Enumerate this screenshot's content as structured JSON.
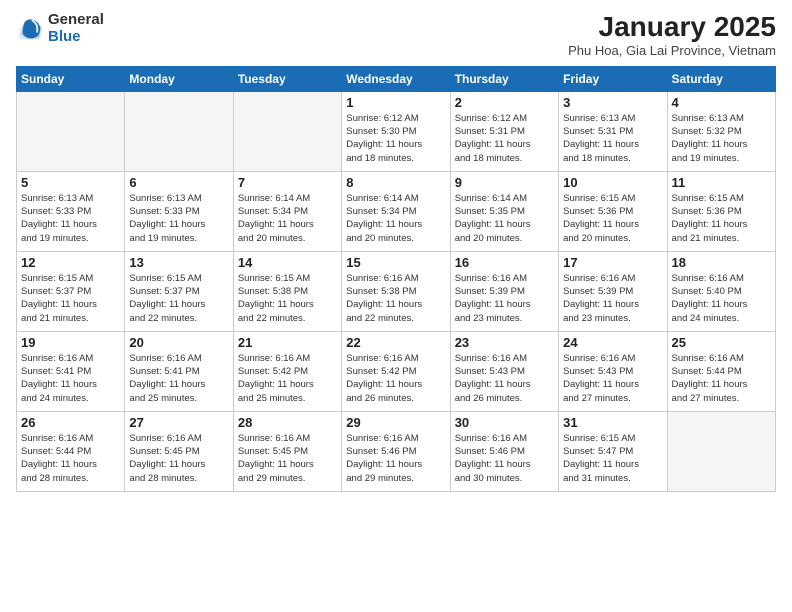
{
  "logo": {
    "general": "General",
    "blue": "Blue"
  },
  "header": {
    "month": "January 2025",
    "location": "Phu Hoa, Gia Lai Province, Vietnam"
  },
  "weekdays": [
    "Sunday",
    "Monday",
    "Tuesday",
    "Wednesday",
    "Thursday",
    "Friday",
    "Saturday"
  ],
  "weeks": [
    [
      {
        "day": "",
        "info": ""
      },
      {
        "day": "",
        "info": ""
      },
      {
        "day": "",
        "info": ""
      },
      {
        "day": "1",
        "info": "Sunrise: 6:12 AM\nSunset: 5:30 PM\nDaylight: 11 hours\nand 18 minutes."
      },
      {
        "day": "2",
        "info": "Sunrise: 6:12 AM\nSunset: 5:31 PM\nDaylight: 11 hours\nand 18 minutes."
      },
      {
        "day": "3",
        "info": "Sunrise: 6:13 AM\nSunset: 5:31 PM\nDaylight: 11 hours\nand 18 minutes."
      },
      {
        "day": "4",
        "info": "Sunrise: 6:13 AM\nSunset: 5:32 PM\nDaylight: 11 hours\nand 19 minutes."
      }
    ],
    [
      {
        "day": "5",
        "info": "Sunrise: 6:13 AM\nSunset: 5:33 PM\nDaylight: 11 hours\nand 19 minutes."
      },
      {
        "day": "6",
        "info": "Sunrise: 6:13 AM\nSunset: 5:33 PM\nDaylight: 11 hours\nand 19 minutes."
      },
      {
        "day": "7",
        "info": "Sunrise: 6:14 AM\nSunset: 5:34 PM\nDaylight: 11 hours\nand 20 minutes."
      },
      {
        "day": "8",
        "info": "Sunrise: 6:14 AM\nSunset: 5:34 PM\nDaylight: 11 hours\nand 20 minutes."
      },
      {
        "day": "9",
        "info": "Sunrise: 6:14 AM\nSunset: 5:35 PM\nDaylight: 11 hours\nand 20 minutes."
      },
      {
        "day": "10",
        "info": "Sunrise: 6:15 AM\nSunset: 5:36 PM\nDaylight: 11 hours\nand 20 minutes."
      },
      {
        "day": "11",
        "info": "Sunrise: 6:15 AM\nSunset: 5:36 PM\nDaylight: 11 hours\nand 21 minutes."
      }
    ],
    [
      {
        "day": "12",
        "info": "Sunrise: 6:15 AM\nSunset: 5:37 PM\nDaylight: 11 hours\nand 21 minutes."
      },
      {
        "day": "13",
        "info": "Sunrise: 6:15 AM\nSunset: 5:37 PM\nDaylight: 11 hours\nand 22 minutes."
      },
      {
        "day": "14",
        "info": "Sunrise: 6:15 AM\nSunset: 5:38 PM\nDaylight: 11 hours\nand 22 minutes."
      },
      {
        "day": "15",
        "info": "Sunrise: 6:16 AM\nSunset: 5:38 PM\nDaylight: 11 hours\nand 22 minutes."
      },
      {
        "day": "16",
        "info": "Sunrise: 6:16 AM\nSunset: 5:39 PM\nDaylight: 11 hours\nand 23 minutes."
      },
      {
        "day": "17",
        "info": "Sunrise: 6:16 AM\nSunset: 5:39 PM\nDaylight: 11 hours\nand 23 minutes."
      },
      {
        "day": "18",
        "info": "Sunrise: 6:16 AM\nSunset: 5:40 PM\nDaylight: 11 hours\nand 24 minutes."
      }
    ],
    [
      {
        "day": "19",
        "info": "Sunrise: 6:16 AM\nSunset: 5:41 PM\nDaylight: 11 hours\nand 24 minutes."
      },
      {
        "day": "20",
        "info": "Sunrise: 6:16 AM\nSunset: 5:41 PM\nDaylight: 11 hours\nand 25 minutes."
      },
      {
        "day": "21",
        "info": "Sunrise: 6:16 AM\nSunset: 5:42 PM\nDaylight: 11 hours\nand 25 minutes."
      },
      {
        "day": "22",
        "info": "Sunrise: 6:16 AM\nSunset: 5:42 PM\nDaylight: 11 hours\nand 26 minutes."
      },
      {
        "day": "23",
        "info": "Sunrise: 6:16 AM\nSunset: 5:43 PM\nDaylight: 11 hours\nand 26 minutes."
      },
      {
        "day": "24",
        "info": "Sunrise: 6:16 AM\nSunset: 5:43 PM\nDaylight: 11 hours\nand 27 minutes."
      },
      {
        "day": "25",
        "info": "Sunrise: 6:16 AM\nSunset: 5:44 PM\nDaylight: 11 hours\nand 27 minutes."
      }
    ],
    [
      {
        "day": "26",
        "info": "Sunrise: 6:16 AM\nSunset: 5:44 PM\nDaylight: 11 hours\nand 28 minutes."
      },
      {
        "day": "27",
        "info": "Sunrise: 6:16 AM\nSunset: 5:45 PM\nDaylight: 11 hours\nand 28 minutes."
      },
      {
        "day": "28",
        "info": "Sunrise: 6:16 AM\nSunset: 5:45 PM\nDaylight: 11 hours\nand 29 minutes."
      },
      {
        "day": "29",
        "info": "Sunrise: 6:16 AM\nSunset: 5:46 PM\nDaylight: 11 hours\nand 29 minutes."
      },
      {
        "day": "30",
        "info": "Sunrise: 6:16 AM\nSunset: 5:46 PM\nDaylight: 11 hours\nand 30 minutes."
      },
      {
        "day": "31",
        "info": "Sunrise: 6:15 AM\nSunset: 5:47 PM\nDaylight: 11 hours\nand 31 minutes."
      },
      {
        "day": "",
        "info": ""
      }
    ]
  ]
}
